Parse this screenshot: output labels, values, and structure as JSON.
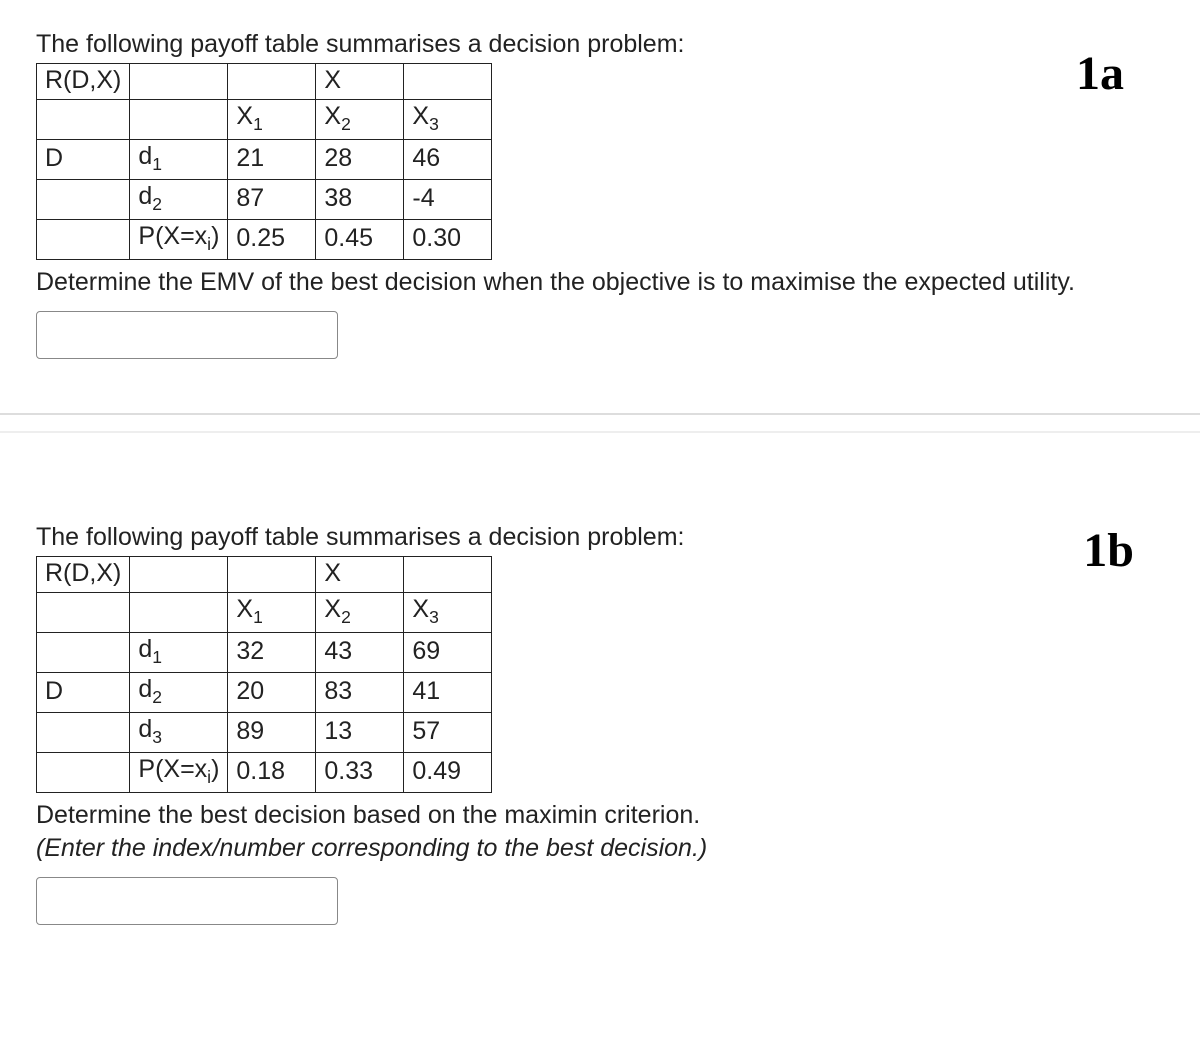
{
  "q1": {
    "tag": "1a",
    "intro": "The following payoff table summarises a decision problem:",
    "header": {
      "RDX": "R(D,X)",
      "X": "X"
    },
    "cols": {
      "x1": "X",
      "x2": "X",
      "x3": "X",
      "s1": "1",
      "s2": "2",
      "s3": "3"
    },
    "rowD": "D",
    "d1": {
      "label": "d",
      "sub": "1",
      "x1": "21",
      "x2": "28",
      "x3": "46"
    },
    "d2": {
      "label": "d",
      "sub": "2",
      "x1": "87",
      "x2": "38",
      "x3": "-4"
    },
    "prob": {
      "label_pre": "P(X=x",
      "label_sub": "i",
      "label_post": ")",
      "p1": "0.25",
      "p2": "0.45",
      "p3": "0.30"
    },
    "question": "Determine the EMV of the best decision when the objective is to maximise the expected utility."
  },
  "q2": {
    "tag": "1b",
    "intro": "The following payoff table summarises a decision problem:",
    "header": {
      "RDX": "R(D,X)",
      "X": "X"
    },
    "cols": {
      "x1": "X",
      "x2": "X",
      "x3": "X",
      "s1": "1",
      "s2": "2",
      "s3": "3"
    },
    "rowD": "D",
    "d1": {
      "label": "d",
      "sub": "1",
      "x1": "32",
      "x2": "43",
      "x3": "69"
    },
    "d2": {
      "label": "d",
      "sub": "2",
      "x1": "20",
      "x2": "83",
      "x3": "41"
    },
    "d3": {
      "label": "d",
      "sub": "3",
      "x1": "89",
      "x2": "13",
      "x3": "57"
    },
    "prob": {
      "label_pre": "P(X=x",
      "label_sub": "i",
      "label_post": ")",
      "p1": "0.18",
      "p2": "0.33",
      "p3": "0.49"
    },
    "question": "Determine the best decision based on the maximin criterion.",
    "hint": "(Enter the index/number corresponding to the best decision.)"
  }
}
